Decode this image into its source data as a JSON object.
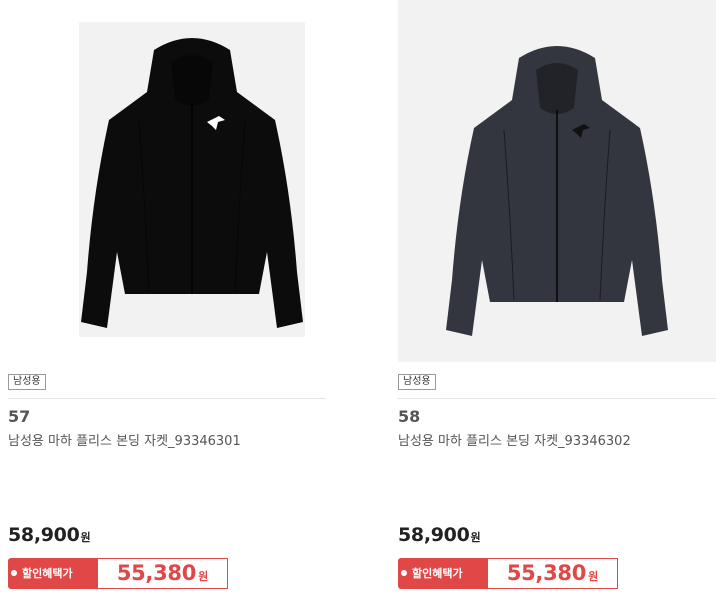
{
  "products": [
    {
      "badge": "남성용",
      "rank": "57",
      "name": "남성용 마하 플리스 본딩 자켓_93346301",
      "price": "58,900",
      "currency": "원",
      "discount_label": "할인혜택가",
      "discount_price": "55,380",
      "jacket_color": "#0c0c0c",
      "logo_color": "#ffffff"
    },
    {
      "badge": "남성용",
      "rank": "58",
      "name": "남성용 마하 플리스 본딩 자켓_93346302",
      "price": "58,900",
      "currency": "원",
      "discount_label": "할인혜택가",
      "discount_price": "55,380",
      "jacket_color": "#33363e",
      "logo_color": "#111111"
    }
  ],
  "colors": {
    "accent": "#e04848",
    "image_bg": "#f2f2f2"
  }
}
